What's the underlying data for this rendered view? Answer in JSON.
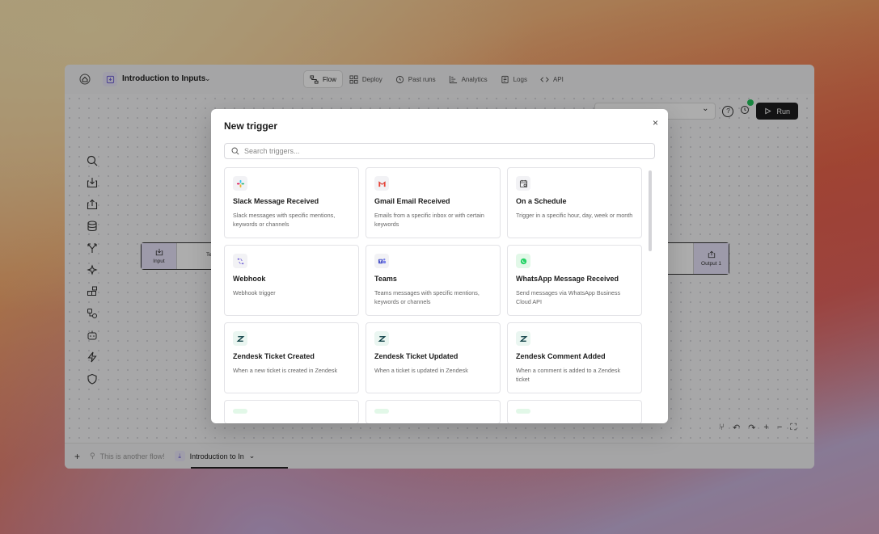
{
  "app": {
    "title": "Introduction to Inputs",
    "tabs": [
      {
        "label": "Flow",
        "icon": "flow-icon"
      },
      {
        "label": "Deploy",
        "icon": "grid-icon"
      },
      {
        "label": "Past runs",
        "icon": "history-icon"
      },
      {
        "label": "Analytics",
        "icon": "chart-icon"
      },
      {
        "label": "Logs",
        "icon": "logs-icon"
      },
      {
        "label": "API",
        "icon": "code-icon"
      }
    ],
    "run_label": "Run",
    "help_glyph": "?"
  },
  "canvas": {
    "input_node_label": "Input",
    "input_node_trailing": "Te",
    "output_node_label": "Output 1"
  },
  "bottom_tabs": {
    "add_glyph": "+",
    "inactive_label": "This is another flow!",
    "active_label": "Introduction to In"
  },
  "modal": {
    "title": "New trigger",
    "close_glyph": "×",
    "search_placeholder": "Search triggers...",
    "triggers": [
      {
        "title": "Slack Message Received",
        "desc": "Slack messages with specific mentions, keywords or channels",
        "icon": "slack-icon",
        "icon_bg": "#f2f2f5"
      },
      {
        "title": "Gmail Email Received",
        "desc": "Emails from a specific inbox or with certain keywords",
        "icon": "gmail-icon",
        "icon_bg": "#f2f2f5"
      },
      {
        "title": "On a Schedule",
        "desc": "Trigger in a specific hour, day, week or month",
        "icon": "calendar-icon",
        "icon_bg": "#f2f2f5"
      },
      {
        "title": "Webhook",
        "desc": "Webhook trigger",
        "icon": "webhook-icon",
        "icon_bg": "#f2f2f5"
      },
      {
        "title": "Teams",
        "desc": "Teams messages with specific mentions, keywords or channels",
        "icon": "teams-icon",
        "icon_bg": "#f2f2f5"
      },
      {
        "title": "WhatsApp Message Received",
        "desc": "Send messages via WhatsApp Business Cloud API",
        "icon": "whatsapp-icon",
        "icon_bg": "#e2f8e8"
      },
      {
        "title": "Zendesk Ticket Created",
        "desc": "When a new ticket is created in Zendesk",
        "icon": "zendesk-icon",
        "icon_bg": "#eaf6f1"
      },
      {
        "title": "Zendesk Ticket Updated",
        "desc": "When a ticket is updated in Zendesk",
        "icon": "zendesk-icon",
        "icon_bg": "#eaf6f1"
      },
      {
        "title": "Zendesk Comment Added",
        "desc": "When a comment is added to a Zendesk ticket",
        "icon": "zendesk-icon",
        "icon_bg": "#eaf6f1"
      }
    ]
  },
  "colors": {
    "accent_dark": "#1c1c1e",
    "status_green": "#22c55e",
    "node_fill": "#e8e4fb"
  }
}
